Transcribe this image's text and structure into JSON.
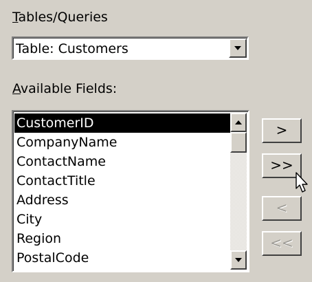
{
  "tables_queries": {
    "label": "Tables/Queries",
    "accelerator": "T",
    "label_rest": "ables/Queries",
    "selected": "Table: Customers"
  },
  "available_fields": {
    "accelerator": "A",
    "label_rest": "vailable Fields:",
    "selected_index": 0,
    "items": [
      "CustomerID",
      "CompanyName",
      "ContactName",
      "ContactTitle",
      "Address",
      "City",
      "Region",
      "PostalCode"
    ]
  },
  "buttons": {
    "add": ">",
    "add_all": ">>",
    "remove": "<",
    "remove_all": "<<"
  },
  "icons": {
    "combo_dropdown": "chevron-down-icon",
    "scroll_up": "scroll-up-arrow-icon",
    "scroll_down": "scroll-down-arrow-icon",
    "cursor": "mouse-pointer-icon"
  },
  "colors": {
    "dialog_bg": "#d4d0c8",
    "selection_bg": "#000000",
    "selection_fg": "#ffffff",
    "disabled_text": "#9c9a94"
  }
}
